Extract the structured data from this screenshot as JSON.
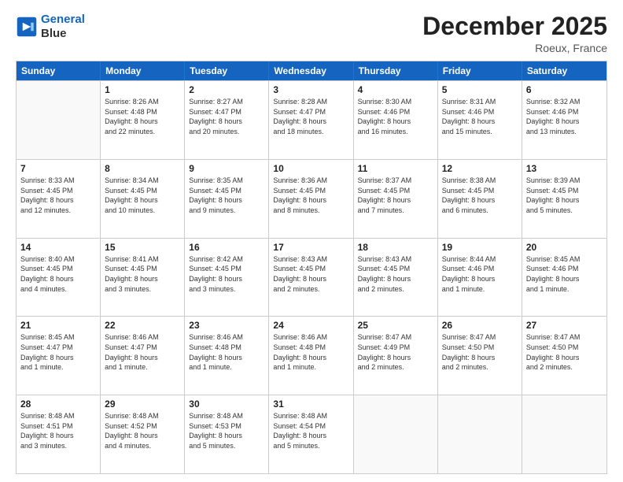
{
  "header": {
    "logo_line1": "General",
    "logo_line2": "Blue",
    "month": "December 2025",
    "location": "Roeux, France"
  },
  "days": [
    "Sunday",
    "Monday",
    "Tuesday",
    "Wednesday",
    "Thursday",
    "Friday",
    "Saturday"
  ],
  "rows": [
    [
      {
        "date": "",
        "info": ""
      },
      {
        "date": "1",
        "info": "Sunrise: 8:26 AM\nSunset: 4:48 PM\nDaylight: 8 hours\nand 22 minutes."
      },
      {
        "date": "2",
        "info": "Sunrise: 8:27 AM\nSunset: 4:47 PM\nDaylight: 8 hours\nand 20 minutes."
      },
      {
        "date": "3",
        "info": "Sunrise: 8:28 AM\nSunset: 4:47 PM\nDaylight: 8 hours\nand 18 minutes."
      },
      {
        "date": "4",
        "info": "Sunrise: 8:30 AM\nSunset: 4:46 PM\nDaylight: 8 hours\nand 16 minutes."
      },
      {
        "date": "5",
        "info": "Sunrise: 8:31 AM\nSunset: 4:46 PM\nDaylight: 8 hours\nand 15 minutes."
      },
      {
        "date": "6",
        "info": "Sunrise: 8:32 AM\nSunset: 4:46 PM\nDaylight: 8 hours\nand 13 minutes."
      }
    ],
    [
      {
        "date": "7",
        "info": "Sunrise: 8:33 AM\nSunset: 4:45 PM\nDaylight: 8 hours\nand 12 minutes."
      },
      {
        "date": "8",
        "info": "Sunrise: 8:34 AM\nSunset: 4:45 PM\nDaylight: 8 hours\nand 10 minutes."
      },
      {
        "date": "9",
        "info": "Sunrise: 8:35 AM\nSunset: 4:45 PM\nDaylight: 8 hours\nand 9 minutes."
      },
      {
        "date": "10",
        "info": "Sunrise: 8:36 AM\nSunset: 4:45 PM\nDaylight: 8 hours\nand 8 minutes."
      },
      {
        "date": "11",
        "info": "Sunrise: 8:37 AM\nSunset: 4:45 PM\nDaylight: 8 hours\nand 7 minutes."
      },
      {
        "date": "12",
        "info": "Sunrise: 8:38 AM\nSunset: 4:45 PM\nDaylight: 8 hours\nand 6 minutes."
      },
      {
        "date": "13",
        "info": "Sunrise: 8:39 AM\nSunset: 4:45 PM\nDaylight: 8 hours\nand 5 minutes."
      }
    ],
    [
      {
        "date": "14",
        "info": "Sunrise: 8:40 AM\nSunset: 4:45 PM\nDaylight: 8 hours\nand 4 minutes."
      },
      {
        "date": "15",
        "info": "Sunrise: 8:41 AM\nSunset: 4:45 PM\nDaylight: 8 hours\nand 3 minutes."
      },
      {
        "date": "16",
        "info": "Sunrise: 8:42 AM\nSunset: 4:45 PM\nDaylight: 8 hours\nand 3 minutes."
      },
      {
        "date": "17",
        "info": "Sunrise: 8:43 AM\nSunset: 4:45 PM\nDaylight: 8 hours\nand 2 minutes."
      },
      {
        "date": "18",
        "info": "Sunrise: 8:43 AM\nSunset: 4:45 PM\nDaylight: 8 hours\nand 2 minutes."
      },
      {
        "date": "19",
        "info": "Sunrise: 8:44 AM\nSunset: 4:46 PM\nDaylight: 8 hours\nand 1 minute."
      },
      {
        "date": "20",
        "info": "Sunrise: 8:45 AM\nSunset: 4:46 PM\nDaylight: 8 hours\nand 1 minute."
      }
    ],
    [
      {
        "date": "21",
        "info": "Sunrise: 8:45 AM\nSunset: 4:47 PM\nDaylight: 8 hours\nand 1 minute."
      },
      {
        "date": "22",
        "info": "Sunrise: 8:46 AM\nSunset: 4:47 PM\nDaylight: 8 hours\nand 1 minute."
      },
      {
        "date": "23",
        "info": "Sunrise: 8:46 AM\nSunset: 4:48 PM\nDaylight: 8 hours\nand 1 minute."
      },
      {
        "date": "24",
        "info": "Sunrise: 8:46 AM\nSunset: 4:48 PM\nDaylight: 8 hours\nand 1 minute."
      },
      {
        "date": "25",
        "info": "Sunrise: 8:47 AM\nSunset: 4:49 PM\nDaylight: 8 hours\nand 2 minutes."
      },
      {
        "date": "26",
        "info": "Sunrise: 8:47 AM\nSunset: 4:50 PM\nDaylight: 8 hours\nand 2 minutes."
      },
      {
        "date": "27",
        "info": "Sunrise: 8:47 AM\nSunset: 4:50 PM\nDaylight: 8 hours\nand 2 minutes."
      }
    ],
    [
      {
        "date": "28",
        "info": "Sunrise: 8:48 AM\nSunset: 4:51 PM\nDaylight: 8 hours\nand 3 minutes."
      },
      {
        "date": "29",
        "info": "Sunrise: 8:48 AM\nSunset: 4:52 PM\nDaylight: 8 hours\nand 4 minutes."
      },
      {
        "date": "30",
        "info": "Sunrise: 8:48 AM\nSunset: 4:53 PM\nDaylight: 8 hours\nand 5 minutes."
      },
      {
        "date": "31",
        "info": "Sunrise: 8:48 AM\nSunset: 4:54 PM\nDaylight: 8 hours\nand 5 minutes."
      },
      {
        "date": "",
        "info": ""
      },
      {
        "date": "",
        "info": ""
      },
      {
        "date": "",
        "info": ""
      }
    ]
  ]
}
